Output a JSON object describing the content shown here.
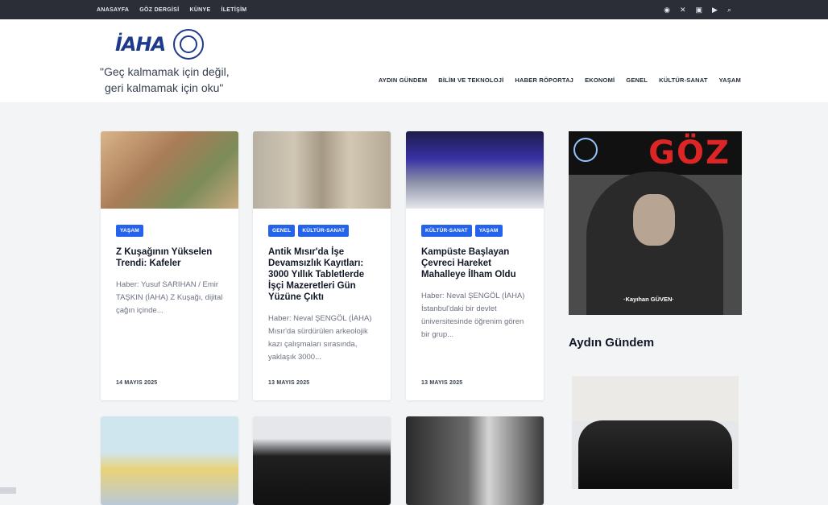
{
  "topnav": [
    "ANASAYFA",
    "GÖZ DERGİSİ",
    "KÜNYE",
    "İLETİŞİM"
  ],
  "topicons": [
    "instagram-icon",
    "x-icon",
    "photo-icon",
    "youtube-icon",
    "search-icon"
  ],
  "logo": {
    "text": "İAHA"
  },
  "tagline": [
    "\"Geç kalmamak için değil,",
    "geri kalmamak için oku\""
  ],
  "mainnav": [
    "AYDIN GÜNDEM",
    "BİLİM VE TEKNOLOJİ",
    "HABER RÖPORTAJ",
    "EKONOMİ",
    "GENEL",
    "KÜLTÜR-SANAT",
    "YAŞAM"
  ],
  "colors": {
    "accent": "#2563eb",
    "topbar": "#2b2e36",
    "brand_red": "#dc2626",
    "brand_blue": "#1e3a8a"
  },
  "cards": [
    {
      "tags": [
        "YAŞAM"
      ],
      "title": "Z Kuşağının Yükselen Trendi: Kafeler",
      "excerpt": "Haber: Yusuf SARIHAN / Emir TAŞKIN (İAHA) Z Kuşağı, dijital çağın içinde...",
      "date": "14 MAYIS 2025"
    },
    {
      "tags": [
        "GENEL",
        "KÜLTÜR-SANAT"
      ],
      "title": "Antik Mısır'da İşe Devamsızlık Kayıtları: 3000 Yıllık Tabletlerde İşçi Mazeretleri Gün Yüzüne Çıktı",
      "excerpt": "Haber: Neval ŞENGÖL (İAHA) Mısır'da sürdürülen arkeolojik kazı çalışmaları sırasında, yaklaşık 3000...",
      "date": "13 MAYIS 2025"
    },
    {
      "tags": [
        "KÜLTÜR-SANAT",
        "YAŞAM"
      ],
      "title": "Kampüste Başlayan Çevreci Hareket Mahalleye İlham Oldu",
      "excerpt": "Haber: Neval ŞENGÖL (İAHA) İstanbul'daki bir devlet üniversitesinde öğrenim gören bir grup...",
      "date": "13 MAYIS 2025"
    }
  ],
  "sidebar": {
    "banner_title": "GÖZ",
    "banner_person": "·Kayıhan GÜVEN·",
    "section_title": "Aydın Gündem"
  }
}
